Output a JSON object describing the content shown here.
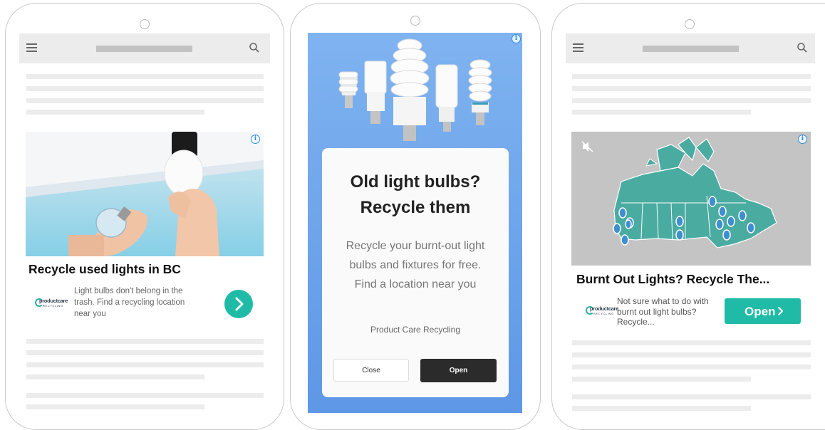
{
  "colors": {
    "accent_teal": "#1fbba6",
    "info_blue": "#2b8fe0",
    "ad2_background": "#6fa6ee",
    "open_dark": "#2b2b2b",
    "placeholder_gray": "#ececec"
  },
  "icons": {
    "menu": "hamburger-icon",
    "search": "magnifier-icon",
    "info": "info-circle-icon",
    "arrow": "chevron-right-icon",
    "mute": "speaker-muted-icon"
  },
  "ad1": {
    "info_glyph": "i",
    "title": "Recycle used lights in BC",
    "logo_brand": "productcare",
    "logo_sub": "RECYCLING",
    "description": "Light bulbs don't belong in the trash. Find a recycling location near you",
    "arrow_glyph": "›"
  },
  "ad2": {
    "info_glyph": "i",
    "title_line1": "Old light bulbs?",
    "title_line2": "Recycle them",
    "description": "Recycle your burnt-out light bulbs and fixtures for free. Find a location near you",
    "advertiser": "Product Care Recycling",
    "close_label": "Close",
    "open_label": "Open"
  },
  "ad3": {
    "info_glyph": "i",
    "title": "Burnt Out Lights? Recycle The...",
    "logo_brand": "productcare",
    "logo_sub": "RECYCLING",
    "description": "Not sure what to do with burnt out light bulbs? Recycle...",
    "open_label": "Open",
    "open_glyph": "›"
  }
}
